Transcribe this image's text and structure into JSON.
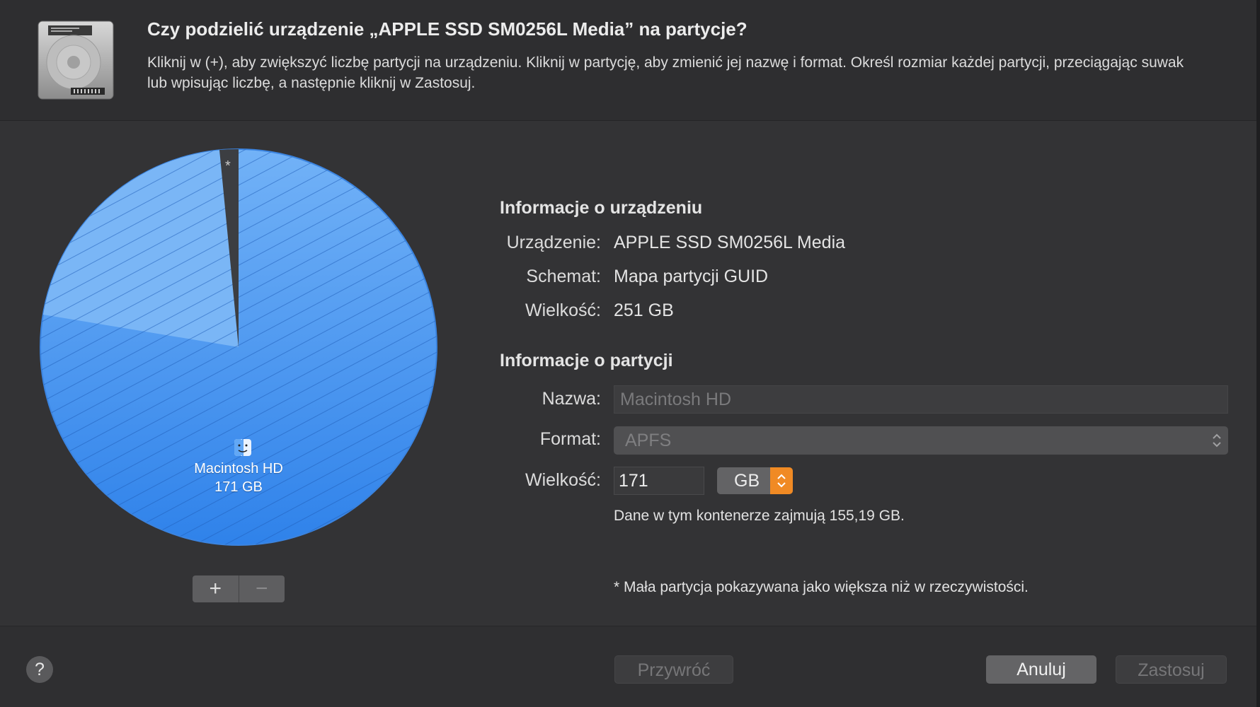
{
  "dialog": {
    "title": "Czy podzielić urządzenie „APPLE SSD SM0256L Media” na partycje?",
    "description": "Kliknij w (+), aby zwiększyć liczbę partycji na urządzeniu. Kliknij w partycję, aby zmienić jej nazwę i format. Określ rozmiar każdej partycji, przeciągając suwak lub wpisując liczbę, a następnie kliknij w Zastosuj."
  },
  "pie": {
    "asterisk": "*",
    "volume_name": "Macintosh HD",
    "volume_size": "171 GB",
    "colors": {
      "main": "#3d8ef0",
      "light": "#6fb0f5",
      "dark_slice": "#3a3c40"
    }
  },
  "buttons": {
    "add": "+",
    "remove": "−"
  },
  "device_info": {
    "heading": "Informacje o urządzeniu",
    "device_label": "Urządzenie:",
    "device_value": "APPLE SSD SM0256L Media",
    "scheme_label": "Schemat:",
    "scheme_value": "Mapa partycji GUID",
    "size_label": "Wielkość:",
    "size_value": "251 GB"
  },
  "partition_info": {
    "heading": "Informacje o partycji",
    "name_label": "Nazwa:",
    "name_value": "Macintosh HD",
    "format_label": "Format:",
    "format_value": "APFS",
    "size_label": "Wielkość:",
    "size_value": "171",
    "unit": "GB",
    "container_note": "Dane w tym kontenerze zajmują 155,19 GB.",
    "small_note": "* Mała partycja pokazywana jako większa niż w rzeczywistości."
  },
  "footer": {
    "help": "?",
    "restore": "Przywróć",
    "cancel": "Anuluj",
    "apply": "Zastosuj"
  }
}
